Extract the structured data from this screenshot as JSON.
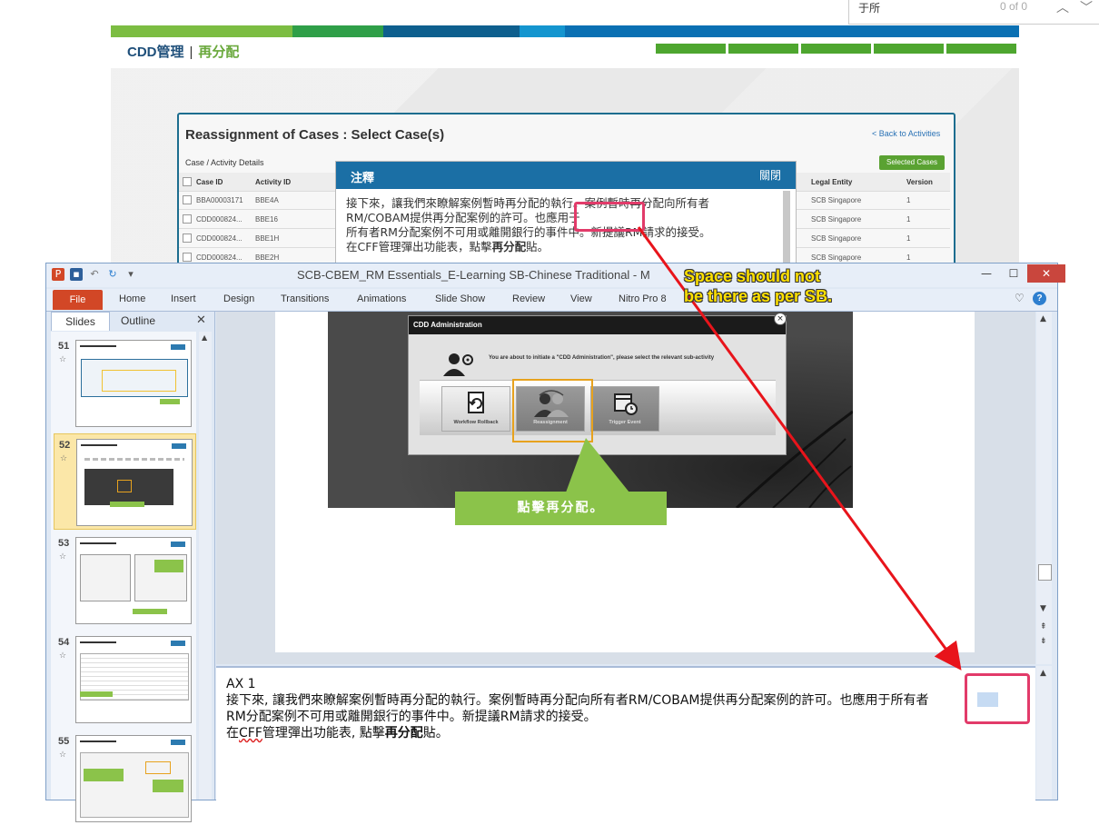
{
  "find_bar": {
    "query": "于所",
    "count": "0 of 0"
  },
  "web_header": {
    "title": "CDD管理",
    "separator": "|",
    "subtitle": "再分配"
  },
  "stripe_colors": [
    "#7cbd42",
    "#2f9f48",
    "#0e5f8e",
    "#1495cf",
    "#0a70b3"
  ],
  "dialog": {
    "title": "Reassignment of Cases : Select Case(s)",
    "back_link": "< Back to Activities",
    "section": "Case / Activity Details",
    "selected_button": "Selected Cases",
    "columns": [
      "Case ID",
      "Activity ID",
      "Legal Entity",
      "Version"
    ],
    "rows": [
      [
        "BBA00003171",
        "BBE4A",
        "SCB Singapore",
        "1"
      ],
      [
        "CDD000824...",
        "BBE16",
        "SCB Singapore",
        "1"
      ],
      [
        "CDD000824...",
        "BBE1H",
        "SCB Singapore",
        "1"
      ],
      [
        "CDD000824...",
        "BBE2H",
        "SCB Singapore",
        "1"
      ]
    ]
  },
  "note_popup": {
    "title": "注釋",
    "close": "關閉",
    "lines": [
      "接下來，讓我們來瞭解案例暫時再分配的執行。案例暫時再分配向所有者",
      "RM/COBAM提供再分配案例的許可。也應用于",
      "所有者RM分配案例不可用或離開銀行的事件中。新提議RM請求的接受。"
    ],
    "line4_prefix": "在CFF管理彈出功能表，點擊",
    "line4_bold": "再分配",
    "line4_suffix": "貼。"
  },
  "ppt": {
    "window_title": "SCB-CBEM_RM Essentials_E-Learning SB-Chinese Traditional  -  M",
    "win_buttons": {
      "minimize": "—",
      "restore": "☐",
      "close": "✕"
    },
    "tabs": [
      "File",
      "Home",
      "Insert",
      "Design",
      "Transitions",
      "Animations",
      "Slide Show",
      "Review",
      "View",
      "Nitro Pro 8"
    ],
    "pane_tabs": {
      "slides": "Slides",
      "outline": "Outline",
      "close": "✕"
    },
    "thumbnails": [
      "51",
      "52",
      "53",
      "54",
      "55"
    ],
    "selected_thumbnail": "52",
    "star": "☆"
  },
  "slide": {
    "modal_title": "CDD Administration",
    "modal_close": "×",
    "modal_message": "You are about to initiate a \"CDD Administration\", please select the relevant sub-activity",
    "tiles": [
      "Workflow Rollback",
      "Reassignment",
      "Trigger Event"
    ],
    "callout": "點擊再分配。"
  },
  "notes": {
    "heading": "AX 1",
    "line1": "接下來, 讓我們來瞭解案例暫時再分配的執行。案例暫時再分配向所有者RM/COBAM提供再分配案例的許可。也應用于所有者",
    "line2": "RM分配案例不可用或離開銀行的事件中。新提議RM請求的接受。",
    "line3_a": "在",
    "line3_b": "CFF",
    "line3_c": "管理彈出功能表, 點擊",
    "line3_bold": "再分配",
    "line3_d": "貼。"
  },
  "annotation": {
    "line1": "Space should not",
    "line2": "be there as per SB."
  },
  "colors": {
    "accent_green": "#8bc34a",
    "highlight_pink": "#e23b6a",
    "arrow_red": "#e8141b",
    "annotation_yellow": "#ffe100"
  }
}
